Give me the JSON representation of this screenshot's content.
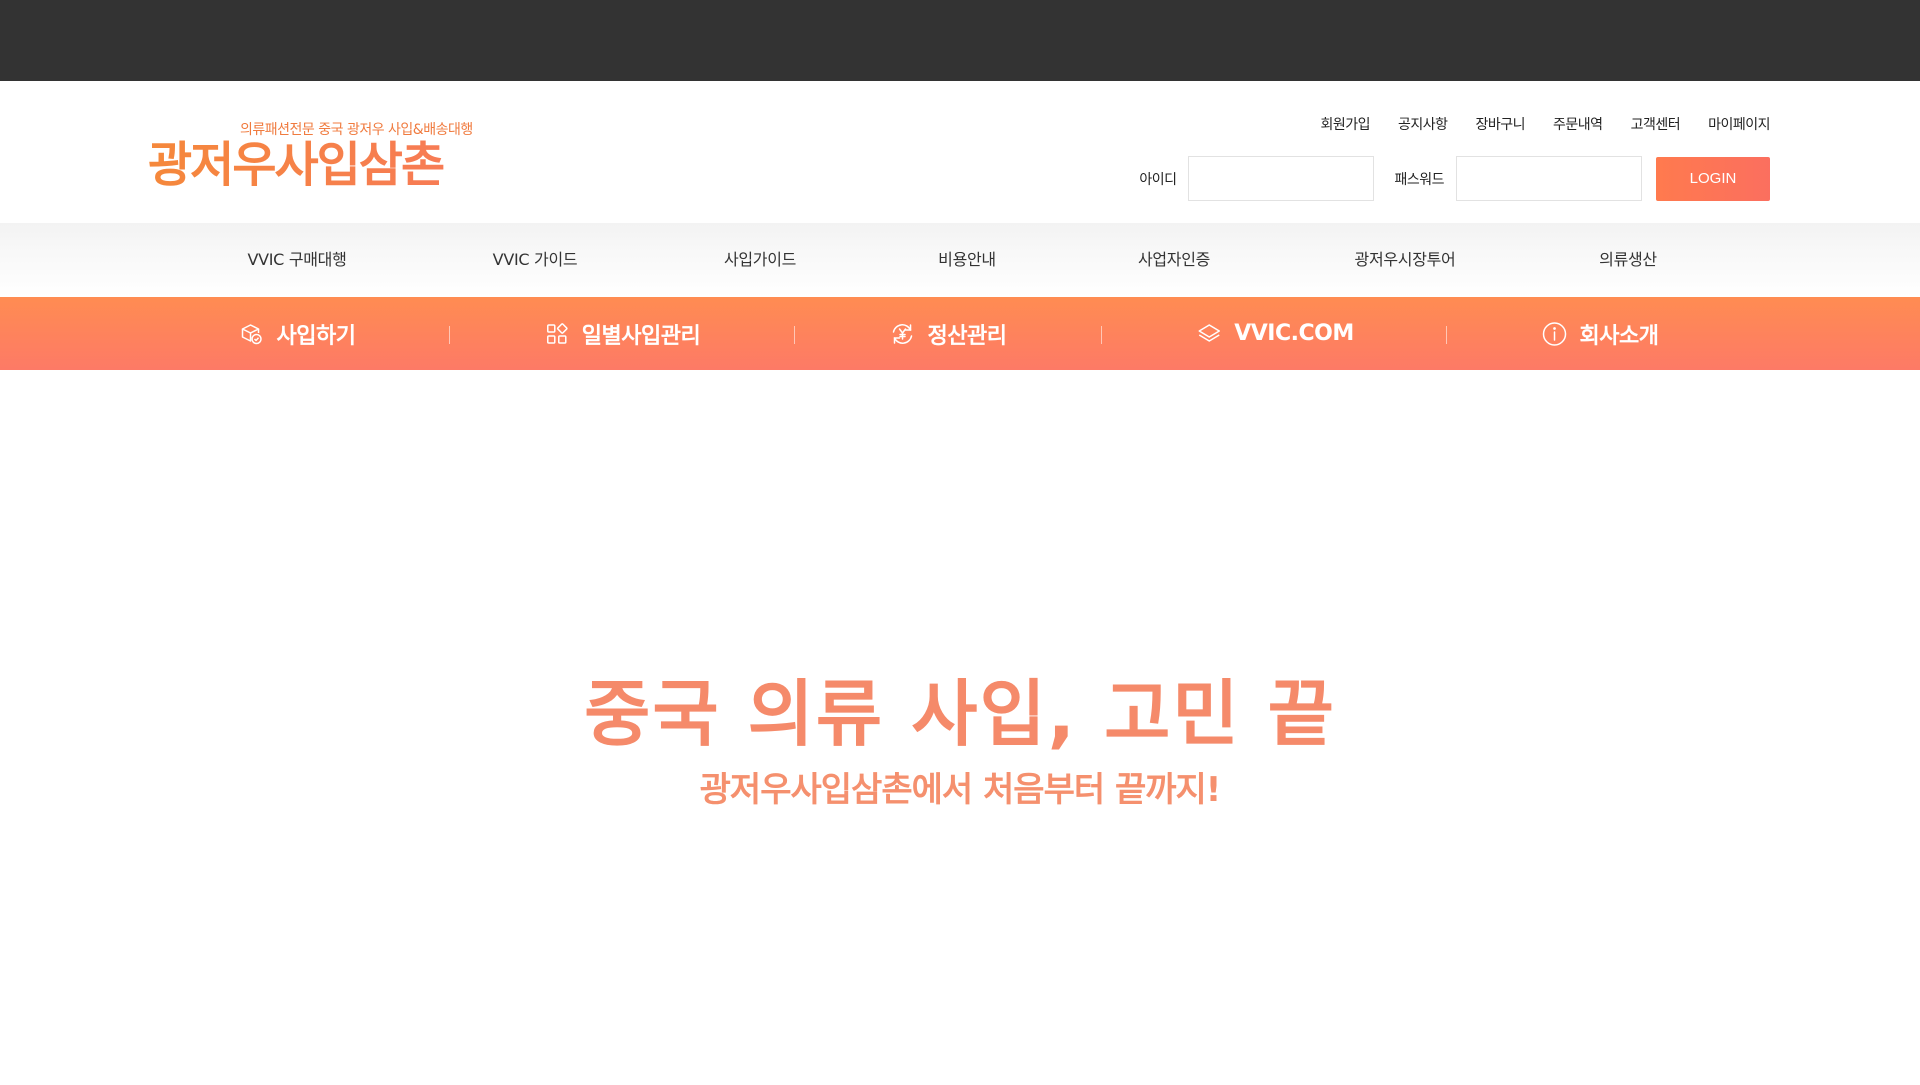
{
  "header": {
    "logo": {
      "tagline": "의류패션전문 중국 광저우 사입&배송대행",
      "title": "광저우사입삼촌"
    },
    "top_links": [
      "회원가입",
      "공지사항",
      "장바구니",
      "주문내역",
      "고객센터",
      "마이페이지"
    ],
    "login": {
      "id_label": "아이디",
      "id_value": "",
      "password_label": "패스워드",
      "password_value": "",
      "button_label": "LOGIN"
    }
  },
  "gnb": {
    "items": [
      "VVIC 구매대행",
      "VVIC 가이드",
      "사입가이드",
      "비용안내",
      "사업자인증",
      "광저우시장투어",
      "의류생산"
    ]
  },
  "quick_nav": {
    "items": [
      {
        "label": "사입하기",
        "icon": "box-check-icon"
      },
      {
        "label": "일별사입관리",
        "icon": "grid-icon"
      },
      {
        "label": "정산관리",
        "icon": "yen-cycle-icon"
      },
      {
        "label": "VVIC.COM",
        "icon": "layers-icon"
      },
      {
        "label": "회사소개",
        "icon": "info-icon"
      }
    ]
  },
  "hero": {
    "title": "중국 의류 사입, 고민 끝",
    "subtitle": "광저우사입삼촌에서 처음부터 끝까지!"
  },
  "colors": {
    "topbar": "#333333",
    "accent": "#ff8654",
    "hero_text": "#f58a6a"
  }
}
